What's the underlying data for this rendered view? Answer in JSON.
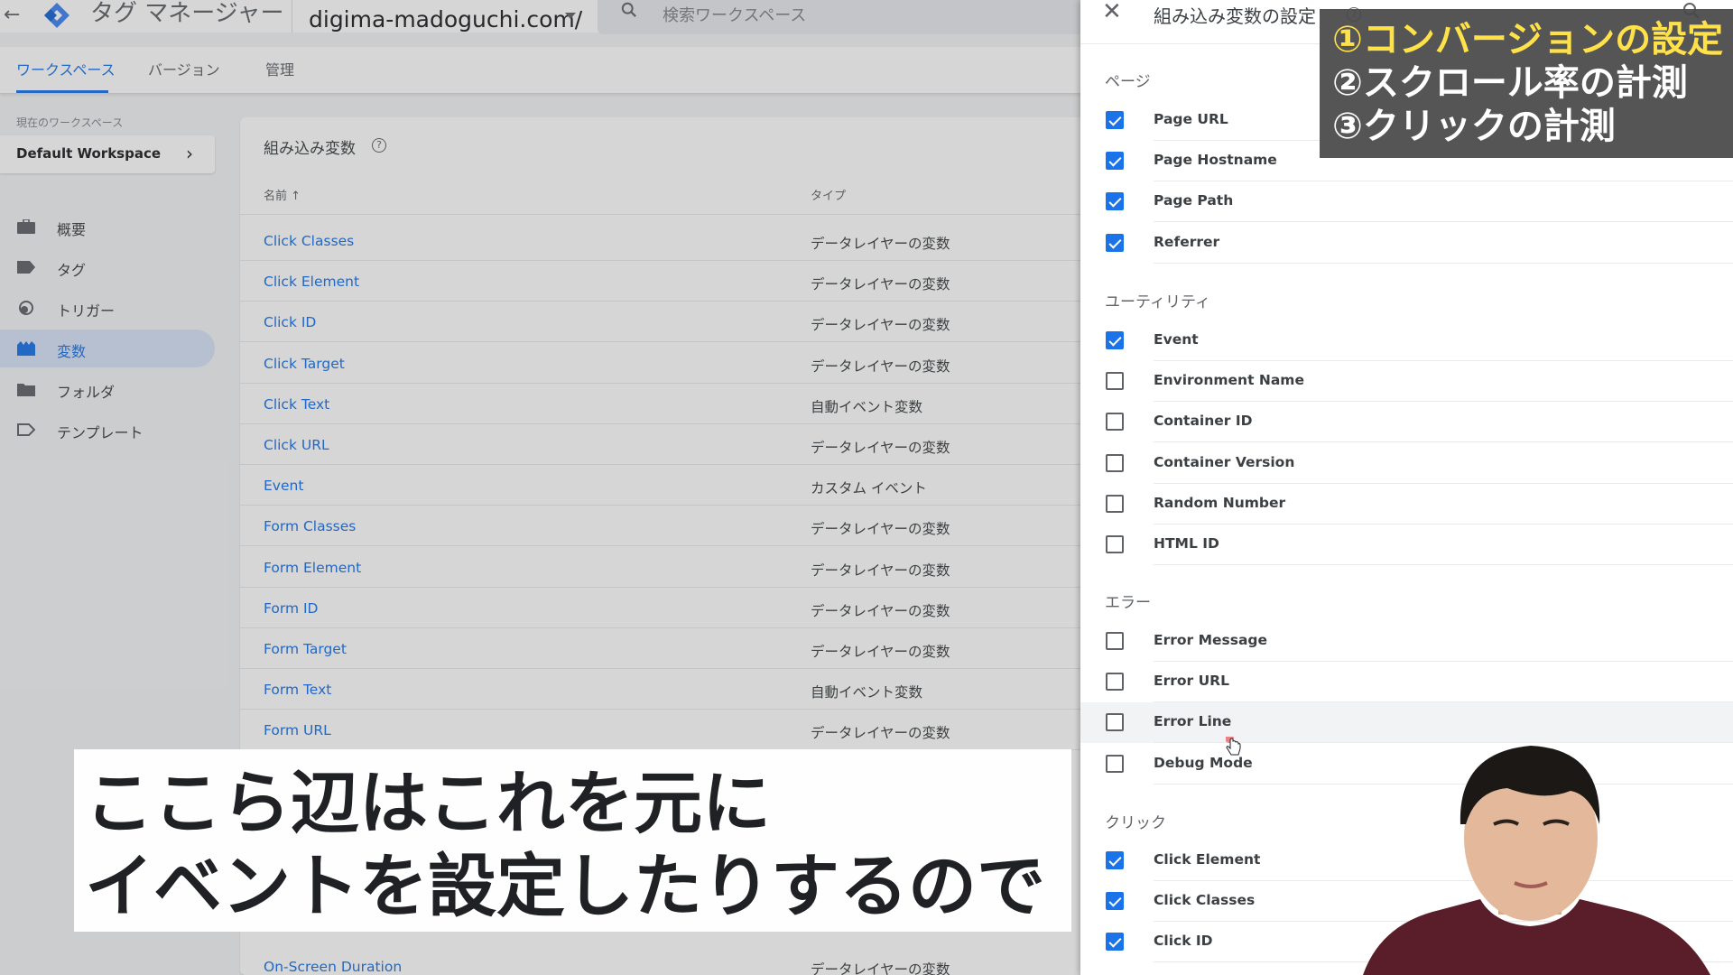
{
  "app": {
    "title": "タグ マネージャー",
    "account_label": "",
    "container_name": "digima-madoguchi.com/",
    "search_placeholder": "検索ワークスペース"
  },
  "tabs": [
    {
      "label": "ワークスペース",
      "active": true
    },
    {
      "label": "バージョン",
      "active": false
    },
    {
      "label": "管理",
      "active": false
    }
  ],
  "workspace": {
    "label": "現在のワークスペース",
    "name": "Default Workspace"
  },
  "nav": [
    {
      "label": "概要",
      "icon": "briefcase-icon",
      "active": false
    },
    {
      "label": "タグ",
      "icon": "tag-icon",
      "active": false
    },
    {
      "label": "トリガー",
      "icon": "trigger-icon",
      "active": false
    },
    {
      "label": "変数",
      "icon": "variables-icon",
      "active": true
    },
    {
      "label": "フォルダ",
      "icon": "folder-icon",
      "active": false
    },
    {
      "label": "テンプレート",
      "icon": "template-icon",
      "active": false
    }
  ],
  "builtin_list": {
    "title": "組み込み変数",
    "col_name": "名前",
    "col_type": "タイプ",
    "rows": [
      {
        "name": "Click Classes",
        "type": "データレイヤーの変数"
      },
      {
        "name": "Click Element",
        "type": "データレイヤーの変数"
      },
      {
        "name": "Click ID",
        "type": "データレイヤーの変数"
      },
      {
        "name": "Click Target",
        "type": "データレイヤーの変数"
      },
      {
        "name": "Click Text",
        "type": "自動イベント変数"
      },
      {
        "name": "Click URL",
        "type": "データレイヤーの変数"
      },
      {
        "name": "Event",
        "type": "カスタム イベント"
      },
      {
        "name": "Form Classes",
        "type": "データレイヤーの変数"
      },
      {
        "name": "Form Element",
        "type": "データレイヤーの変数"
      },
      {
        "name": "Form ID",
        "type": "データレイヤーの変数"
      },
      {
        "name": "Form Target",
        "type": "データレイヤーの変数"
      },
      {
        "name": "Form Text",
        "type": "自動イベント変数"
      },
      {
        "name": "Form URL",
        "type": "データレイヤーの変数"
      }
    ],
    "last_row": {
      "name": "On-Screen Duration",
      "type": "データレイヤーの変数"
    }
  },
  "panel": {
    "title": "組み込み変数の設定",
    "sections": [
      {
        "title": "ページ",
        "options": [
          {
            "label": "Page URL",
            "checked": true
          },
          {
            "label": "Page Hostname",
            "checked": true
          },
          {
            "label": "Page Path",
            "checked": true
          },
          {
            "label": "Referrer",
            "checked": true
          }
        ]
      },
      {
        "title": "ユーティリティ",
        "options": [
          {
            "label": "Event",
            "checked": true
          },
          {
            "label": "Environment Name",
            "checked": false
          },
          {
            "label": "Container ID",
            "checked": false
          },
          {
            "label": "Container Version",
            "checked": false
          },
          {
            "label": "Random Number",
            "checked": false
          },
          {
            "label": "HTML ID",
            "checked": false
          }
        ]
      },
      {
        "title": "エラー",
        "options": [
          {
            "label": "Error Message",
            "checked": false
          },
          {
            "label": "Error URL",
            "checked": false
          },
          {
            "label": "Error Line",
            "checked": false,
            "hover": true
          },
          {
            "label": "Debug Mode",
            "checked": false
          }
        ]
      },
      {
        "title": "クリック",
        "options": [
          {
            "label": "Click Element",
            "checked": true
          },
          {
            "label": "Click Classes",
            "checked": true
          },
          {
            "label": "Click ID",
            "checked": true
          }
        ]
      }
    ]
  },
  "overlay": {
    "steps": [
      "①コンバージョンの設定",
      "②スクロール率の計測",
      "③クリックの計測"
    ],
    "caption": [
      "ここら辺はこれを元に",
      "イベントを設定したりするので"
    ]
  },
  "colors": {
    "accent": "#1a73e8",
    "step_highlight": "#ffe14a",
    "overlay_bg": "#484848"
  }
}
